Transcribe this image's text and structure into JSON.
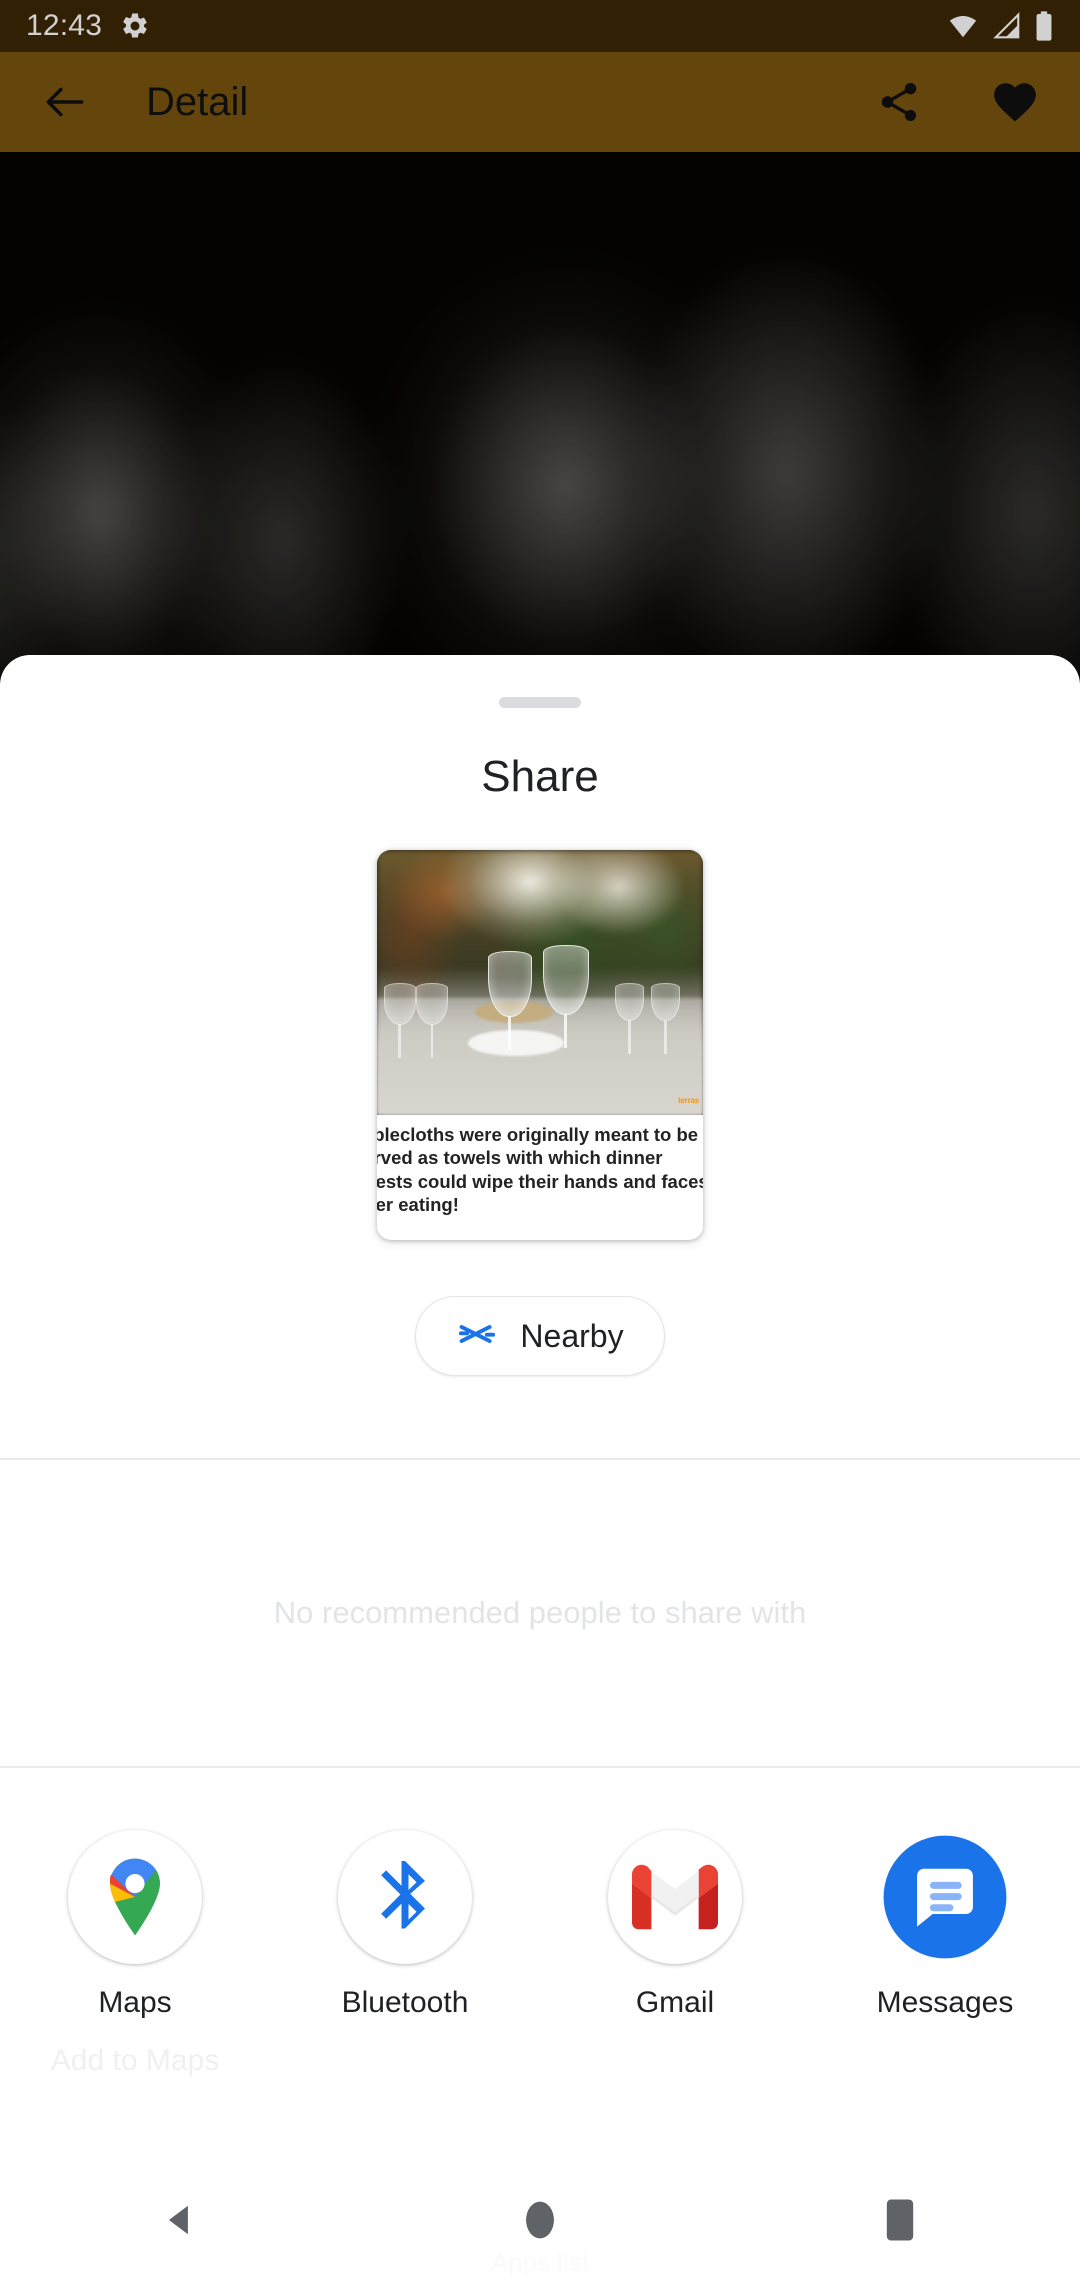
{
  "status_bar": {
    "time": "12:43",
    "icons": [
      "gear-icon",
      "wifi-icon",
      "cellular-signal-icon",
      "battery-icon"
    ]
  },
  "app_bar": {
    "back_icon": "back-arrow-icon",
    "title": "Detail",
    "share_icon": "share-icon",
    "favorite_icon": "heart-icon"
  },
  "share_sheet": {
    "title": "Share",
    "preview": {
      "image_alt": "restaurant-table-with-wine-glasses",
      "watermark": "terras",
      "caption_lines": [
        "Tablecloths were originally meant to be",
        "served as towels with which dinner",
        "guests could wipe their hands and faces",
        "after eating!"
      ]
    },
    "nearby": {
      "label": "Nearby",
      "icon": "nearby-share-icon",
      "icon_color": "#1a73e8"
    },
    "people": {
      "empty_text": "No recommended people to share with"
    },
    "apps": [
      {
        "label": "Maps",
        "sublabel": "Add to Maps",
        "icon": "google-maps-icon"
      },
      {
        "label": "Bluetooth",
        "sublabel": "",
        "icon": "bluetooth-icon"
      },
      {
        "label": "Gmail",
        "sublabel": "",
        "icon": "gmail-icon"
      },
      {
        "label": "Messages",
        "sublabel": "",
        "icon": "messages-icon"
      }
    ]
  },
  "nav_bar": {
    "back": "back-nav-icon",
    "home": "home-nav-icon",
    "recents": "recents-nav-icon",
    "caption": "Apps list"
  },
  "colors": {
    "app_bar": "#7a5611",
    "status_bar": "#3d2806",
    "accent_blue": "#1a73e8",
    "sheet": "#ffffff"
  }
}
